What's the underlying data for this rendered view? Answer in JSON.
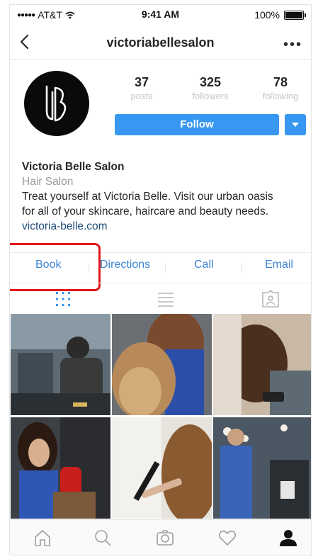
{
  "status": {
    "carrier": "AT&T",
    "time": "9:41 AM",
    "battery": "100%"
  },
  "nav": {
    "title": "victoriabellesalon"
  },
  "stats": [
    {
      "num": "37",
      "label": "posts"
    },
    {
      "num": "325",
      "label": "followers"
    },
    {
      "num": "78",
      "label": "following"
    }
  ],
  "follow_label": "Follow",
  "bio": {
    "name": "Victoria Belle Salon",
    "category": "Hair Salon",
    "desc_line1": "Treat yourself at Victoria Belle. Visit our urban oasis",
    "desc_line2": "for all of your skincare, haircare and beauty needs.",
    "website": "victoria-belle.com"
  },
  "actions": [
    "Book",
    "Directions",
    "Call",
    "Email"
  ],
  "accent": "#3897f0",
  "highlight_color": "#e0171a",
  "icons": {
    "tabs": [
      "grid-icon",
      "list-icon",
      "tagged-icon"
    ],
    "bottom": [
      "home-icon",
      "search-icon",
      "camera-icon",
      "heart-icon",
      "profile-icon"
    ]
  }
}
